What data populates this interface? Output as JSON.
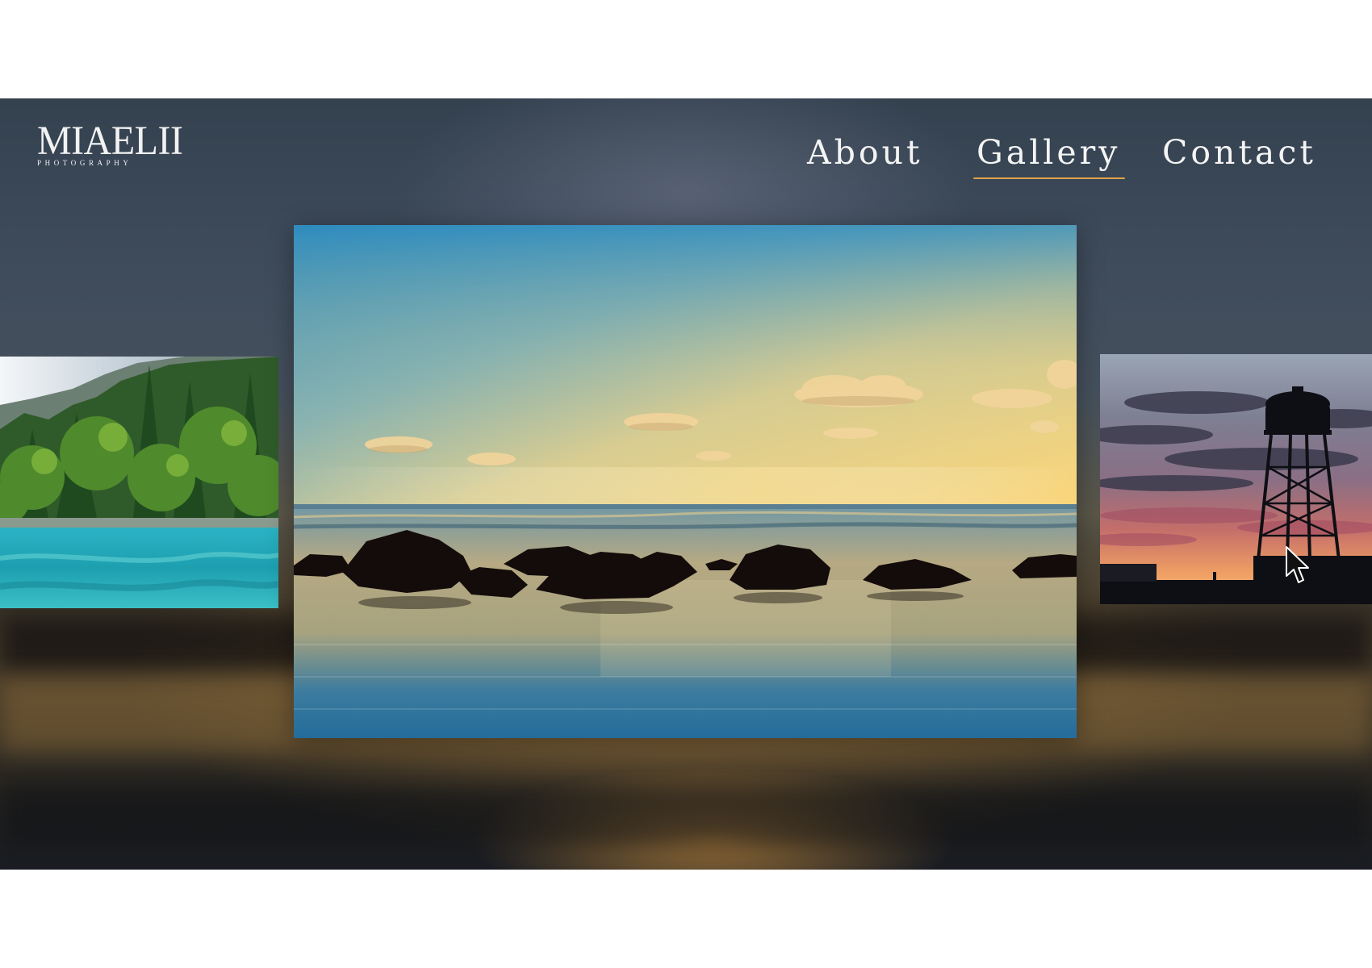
{
  "brand": {
    "name": "MIAELII",
    "tagline": "PHOTOGRAPHY"
  },
  "nav": {
    "items": [
      {
        "label": "About",
        "active": false
      },
      {
        "label": "Gallery",
        "active": true
      },
      {
        "label": "Contact",
        "active": false
      }
    ]
  },
  "gallery": {
    "photos": [
      {
        "subject": "forest lake",
        "position": "previous"
      },
      {
        "subject": "sunset ocean rocks",
        "position": "current"
      },
      {
        "subject": "water tower at dusk",
        "position": "next"
      }
    ]
  },
  "colors": {
    "accent": "#e0a34a",
    "nav_text": "#f4f4f4",
    "background_top": "#34414f"
  }
}
